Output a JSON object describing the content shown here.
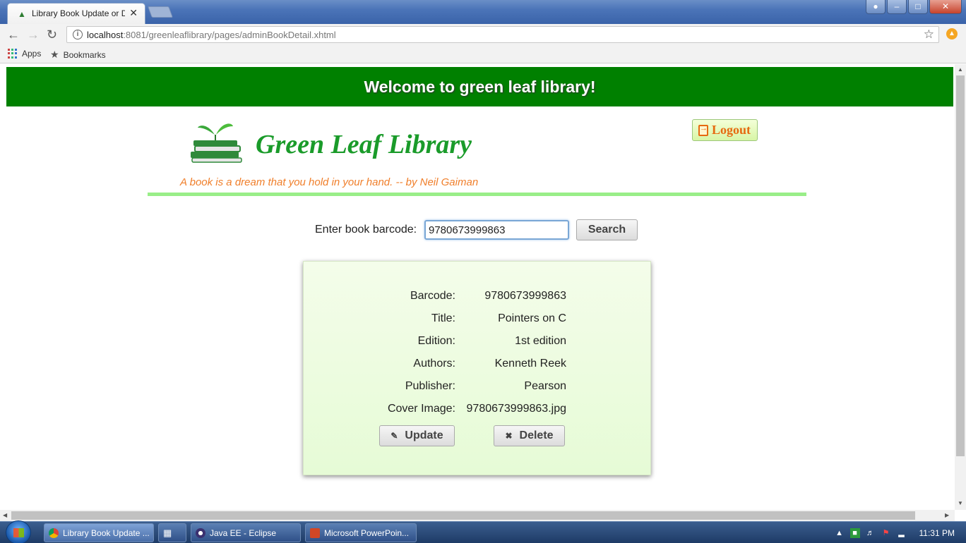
{
  "browser": {
    "tab_title": "Library Book Update or Delete",
    "url_host": "localhost",
    "url_rest": ":8081/greenleaflibrary/pages/adminBookDetail.xhtml",
    "bookmarks": [
      {
        "label": "Apps"
      },
      {
        "label": "Bookmarks"
      }
    ]
  },
  "page": {
    "welcome": "Welcome to green leaf library!",
    "brand": "Green Leaf Library",
    "quote": "A book is a dream that you hold in your hand. -- by Neil Gaiman",
    "logout_label": "Logout",
    "search": {
      "label": "Enter book barcode:",
      "value": "9780673999863",
      "button": "Search"
    },
    "book": {
      "fields": [
        {
          "label": "Barcode:",
          "value": "9780673999863"
        },
        {
          "label": "Title:",
          "value": "Pointers on C"
        },
        {
          "label": "Edition:",
          "value": "1st edition"
        },
        {
          "label": "Authors:",
          "value": "Kenneth Reek"
        },
        {
          "label": "Publisher:",
          "value": "Pearson"
        },
        {
          "label": "Cover Image:",
          "value": "9780673999863.jpg"
        }
      ],
      "update_label": "Update",
      "delete_label": "Delete"
    }
  },
  "taskbar": {
    "tasks": [
      {
        "label": "Library Book Update ..."
      },
      {
        "label": ""
      },
      {
        "label": "Java EE - Eclipse"
      },
      {
        "label": "Microsoft PowerPoin..."
      }
    ],
    "clock": "11:31 PM"
  },
  "colors": {
    "header_green": "#008000",
    "brand_green": "#1a9b2a",
    "quote_orange": "#f07f2b",
    "rule_green": "#99ee88"
  }
}
